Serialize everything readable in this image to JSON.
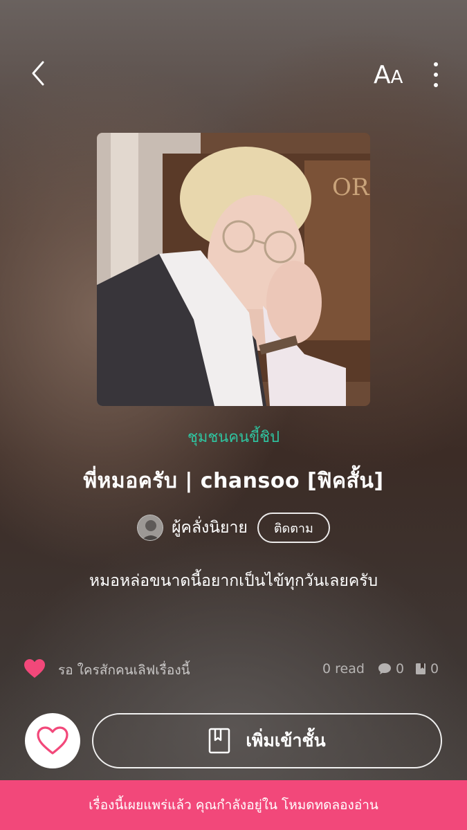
{
  "header": {
    "back_icon": "chevron-left-icon",
    "font_size_big": "A",
    "font_size_small": "A",
    "more_icon": "more-vertical-icon"
  },
  "story": {
    "category": "ชุมชนคนขี้ชิป",
    "title": "พี่หมอครับ | chansoo  [ฟิคสั้น]",
    "author": "ผู้คลั่งนิยาย",
    "follow_label": "ติดตาม",
    "description": "หมอหล่อขนาดนี้อยากเป็นไข้ทุกวันเลยครับ"
  },
  "stats": {
    "like_text": "รอ ใครสักคนเลิฟเรื่องนี้",
    "reads": "0 read",
    "comments": "0",
    "shelf_count": "0"
  },
  "actions": {
    "add_to_shelf_label": "เพิ่มเข้าชั้น"
  },
  "banner": {
    "text": "เรื่องนี้เผยแพร่แล้ว คุณกำลังอยู่ใน โหมดทดลองอ่าน"
  },
  "colors": {
    "accent_pink": "#f2487a",
    "category_green": "#2fc4a0"
  }
}
